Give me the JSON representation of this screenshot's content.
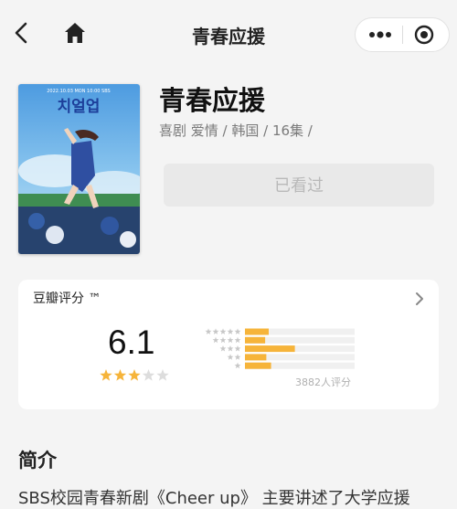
{
  "nav": {
    "title": "青春应援",
    "icons": [
      "chevron-left-icon",
      "home-icon",
      "more-dots-icon",
      "close-target-icon"
    ]
  },
  "movie": {
    "title": "青春应援",
    "meta": "喜剧 爱情 / 韩国 / 16集 /",
    "watched_label": "已看过",
    "poster_texts": [
      "치얼업",
      "2022.10.03 MON 10:00 SBS"
    ]
  },
  "rating": {
    "label": "豆瓣评分 ™",
    "score": "6.1",
    "stars": 3,
    "distribution": [
      0.2,
      0.17,
      0.42,
      0.18,
      0.22
    ],
    "votes": "3882人评分",
    "colors": {
      "bar": "#f6b43a",
      "track": "#f0f0f0",
      "star": "#f6b43a",
      "star_empty": "#dddddd"
    }
  },
  "intro": {
    "title": "简介",
    "text": "SBS校园青春新剧《Cheer up》 主要讲述了大学应援"
  }
}
